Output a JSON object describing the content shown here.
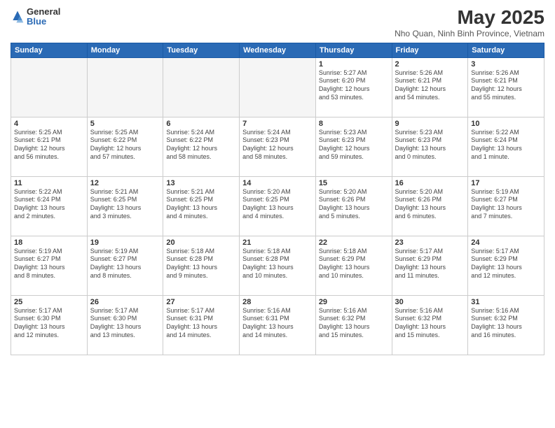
{
  "logo": {
    "general": "General",
    "blue": "Blue"
  },
  "header": {
    "month": "May 2025",
    "location": "Nho Quan, Ninh Binh Province, Vietnam"
  },
  "weekdays": [
    "Sunday",
    "Monday",
    "Tuesday",
    "Wednesday",
    "Thursday",
    "Friday",
    "Saturday"
  ],
  "weeks": [
    [
      {
        "day": "",
        "info": ""
      },
      {
        "day": "",
        "info": ""
      },
      {
        "day": "",
        "info": ""
      },
      {
        "day": "",
        "info": ""
      },
      {
        "day": "1",
        "info": "Sunrise: 5:27 AM\nSunset: 6:20 PM\nDaylight: 12 hours\nand 53 minutes."
      },
      {
        "day": "2",
        "info": "Sunrise: 5:26 AM\nSunset: 6:21 PM\nDaylight: 12 hours\nand 54 minutes."
      },
      {
        "day": "3",
        "info": "Sunrise: 5:26 AM\nSunset: 6:21 PM\nDaylight: 12 hours\nand 55 minutes."
      }
    ],
    [
      {
        "day": "4",
        "info": "Sunrise: 5:25 AM\nSunset: 6:21 PM\nDaylight: 12 hours\nand 56 minutes."
      },
      {
        "day": "5",
        "info": "Sunrise: 5:25 AM\nSunset: 6:22 PM\nDaylight: 12 hours\nand 57 minutes."
      },
      {
        "day": "6",
        "info": "Sunrise: 5:24 AM\nSunset: 6:22 PM\nDaylight: 12 hours\nand 58 minutes."
      },
      {
        "day": "7",
        "info": "Sunrise: 5:24 AM\nSunset: 6:23 PM\nDaylight: 12 hours\nand 58 minutes."
      },
      {
        "day": "8",
        "info": "Sunrise: 5:23 AM\nSunset: 6:23 PM\nDaylight: 12 hours\nand 59 minutes."
      },
      {
        "day": "9",
        "info": "Sunrise: 5:23 AM\nSunset: 6:23 PM\nDaylight: 13 hours\nand 0 minutes."
      },
      {
        "day": "10",
        "info": "Sunrise: 5:22 AM\nSunset: 6:24 PM\nDaylight: 13 hours\nand 1 minute."
      }
    ],
    [
      {
        "day": "11",
        "info": "Sunrise: 5:22 AM\nSunset: 6:24 PM\nDaylight: 13 hours\nand 2 minutes."
      },
      {
        "day": "12",
        "info": "Sunrise: 5:21 AM\nSunset: 6:25 PM\nDaylight: 13 hours\nand 3 minutes."
      },
      {
        "day": "13",
        "info": "Sunrise: 5:21 AM\nSunset: 6:25 PM\nDaylight: 13 hours\nand 4 minutes."
      },
      {
        "day": "14",
        "info": "Sunrise: 5:20 AM\nSunset: 6:25 PM\nDaylight: 13 hours\nand 4 minutes."
      },
      {
        "day": "15",
        "info": "Sunrise: 5:20 AM\nSunset: 6:26 PM\nDaylight: 13 hours\nand 5 minutes."
      },
      {
        "day": "16",
        "info": "Sunrise: 5:20 AM\nSunset: 6:26 PM\nDaylight: 13 hours\nand 6 minutes."
      },
      {
        "day": "17",
        "info": "Sunrise: 5:19 AM\nSunset: 6:27 PM\nDaylight: 13 hours\nand 7 minutes."
      }
    ],
    [
      {
        "day": "18",
        "info": "Sunrise: 5:19 AM\nSunset: 6:27 PM\nDaylight: 13 hours\nand 8 minutes."
      },
      {
        "day": "19",
        "info": "Sunrise: 5:19 AM\nSunset: 6:27 PM\nDaylight: 13 hours\nand 8 minutes."
      },
      {
        "day": "20",
        "info": "Sunrise: 5:18 AM\nSunset: 6:28 PM\nDaylight: 13 hours\nand 9 minutes."
      },
      {
        "day": "21",
        "info": "Sunrise: 5:18 AM\nSunset: 6:28 PM\nDaylight: 13 hours\nand 10 minutes."
      },
      {
        "day": "22",
        "info": "Sunrise: 5:18 AM\nSunset: 6:29 PM\nDaylight: 13 hours\nand 10 minutes."
      },
      {
        "day": "23",
        "info": "Sunrise: 5:17 AM\nSunset: 6:29 PM\nDaylight: 13 hours\nand 11 minutes."
      },
      {
        "day": "24",
        "info": "Sunrise: 5:17 AM\nSunset: 6:29 PM\nDaylight: 13 hours\nand 12 minutes."
      }
    ],
    [
      {
        "day": "25",
        "info": "Sunrise: 5:17 AM\nSunset: 6:30 PM\nDaylight: 13 hours\nand 12 minutes."
      },
      {
        "day": "26",
        "info": "Sunrise: 5:17 AM\nSunset: 6:30 PM\nDaylight: 13 hours\nand 13 minutes."
      },
      {
        "day": "27",
        "info": "Sunrise: 5:17 AM\nSunset: 6:31 PM\nDaylight: 13 hours\nand 14 minutes."
      },
      {
        "day": "28",
        "info": "Sunrise: 5:16 AM\nSunset: 6:31 PM\nDaylight: 13 hours\nand 14 minutes."
      },
      {
        "day": "29",
        "info": "Sunrise: 5:16 AM\nSunset: 6:32 PM\nDaylight: 13 hours\nand 15 minutes."
      },
      {
        "day": "30",
        "info": "Sunrise: 5:16 AM\nSunset: 6:32 PM\nDaylight: 13 hours\nand 15 minutes."
      },
      {
        "day": "31",
        "info": "Sunrise: 5:16 AM\nSunset: 6:32 PM\nDaylight: 13 hours\nand 16 minutes."
      }
    ]
  ]
}
